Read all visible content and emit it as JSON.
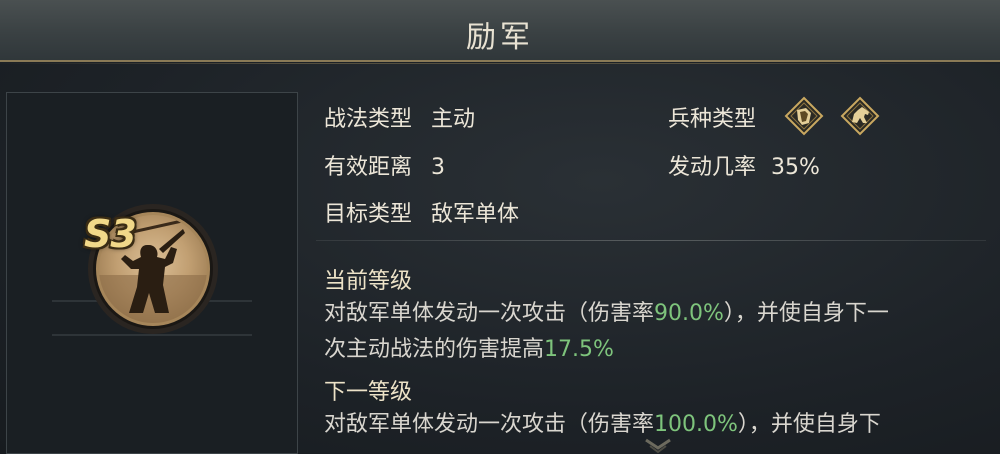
{
  "title": "励军",
  "skill": {
    "grade": "S3",
    "portrait": "warrior-silhouette-icon"
  },
  "attributes": {
    "tactic_type": {
      "label": "战法类型",
      "value": "主动"
    },
    "range": {
      "label": "有效距离",
      "value": "3"
    },
    "target": {
      "label": "目标类型",
      "value": "敌军单体"
    },
    "unit_type": {
      "label": "兵种类型",
      "icons": [
        "shield-unit-icon",
        "cavalry-unit-icon"
      ]
    },
    "trigger_rate": {
      "label": "发动几率",
      "value": "35%"
    }
  },
  "current_level": {
    "heading": "当前等级",
    "line1_a": "对敌军单体发动一次攻击（伤害率",
    "line1_pct": "90.0%",
    "line1_b": "），并使自身下一",
    "line2_a": "次主动战法的伤害提高",
    "line2_pct": "17.5%"
  },
  "next_level": {
    "heading": "下一等级",
    "line1_a": "对敌军单体发动一次攻击（伤害率",
    "line1_pct": "100.0%",
    "line1_b": "），并使自身下"
  },
  "colors": {
    "highlight": "#7ec47c",
    "gold": "#f1d889",
    "text": "#ece6d8"
  }
}
